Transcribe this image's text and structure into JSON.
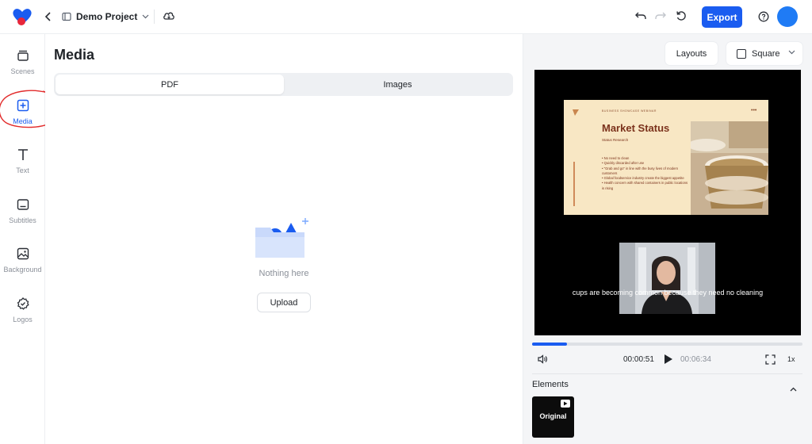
{
  "header": {
    "project_name": "Demo Project",
    "export_label": "Export",
    "colors": {
      "accent": "#1a5cf0",
      "avatar": "#1f7bf5"
    }
  },
  "sidebar": {
    "items": [
      {
        "label": "Scenes",
        "icon": "scenes-icon"
      },
      {
        "label": "Media",
        "icon": "media-plus-icon",
        "active": true
      },
      {
        "label": "Text",
        "icon": "text-icon"
      },
      {
        "label": "Subtitles",
        "icon": "subtitles-icon"
      },
      {
        "label": "Background",
        "icon": "background-icon"
      },
      {
        "label": "Logos",
        "icon": "logos-icon"
      }
    ]
  },
  "media": {
    "title": "Media",
    "tabs": [
      {
        "label": "PDF",
        "selected": true
      },
      {
        "label": "Images",
        "selected": false
      }
    ],
    "empty_text": "Nothing here",
    "upload_label": "Upload"
  },
  "preview": {
    "layouts_label": "Layouts",
    "aspect_label": "Square",
    "slide": {
      "kicker": "BUSINESS SHOWCASE WEBINAR",
      "title": "Market Status",
      "subtitle": "Status Research",
      "bullets": [
        "No need to clean",
        "Quickly discarded after use",
        "\"Grab and go\" in line with the busy lives of modern customers",
        "Global foodservice industry create the biggest appetite",
        "Health concern with shared containers in public locations is rising"
      ]
    },
    "caption": "cups are becoming common because they need no cleaning",
    "progress_fraction": 0.13,
    "current_time": "00:00:51",
    "total_time": "00:06:34",
    "speed": "1x",
    "elements_label": "Elements",
    "element_card_label": "Original"
  }
}
